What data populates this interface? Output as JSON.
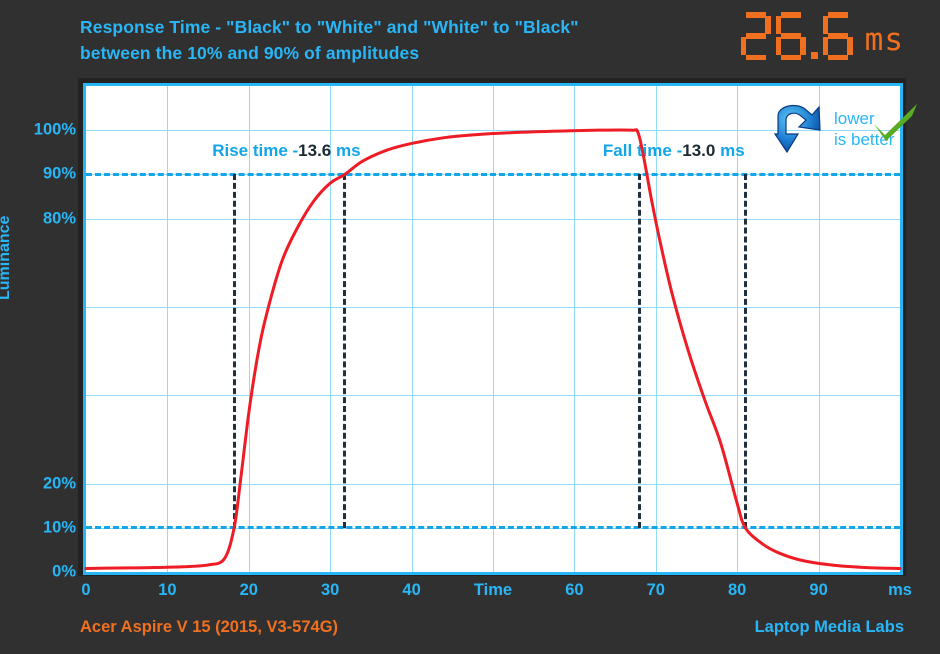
{
  "header": {
    "title_line_1": "Response Time - \"Black\" to \"White\" and \"White\" to \"Black\"",
    "title_line_2": "between the 10% and 90% of amplitudes",
    "readout_value": "26.6",
    "readout_unit": "ms"
  },
  "badge": {
    "line_1": "lower",
    "line_2": "is better",
    "arrow_icon": "down-arrow-icon",
    "check_icon": "green-check-icon"
  },
  "annotations": {
    "rise_label": "Rise time -",
    "rise_value": "13.6",
    "rise_unit": "ms",
    "fall_label": "Fall time -",
    "fall_value": "13.0",
    "fall_unit": "ms"
  },
  "footer": {
    "device": "Acer Aspire V 15 (2015, V3-574G)",
    "source": "Laptop Media Labs"
  },
  "colors": {
    "background": "#303030",
    "accent_cyan": "#29b6f6",
    "accent_orange": "#f07020",
    "curve_red": "#ee1c25",
    "grid_light": "#8fdcfb",
    "marker_dark": "#21303c",
    "plot_bg": "#ffffff"
  },
  "chart_data": {
    "type": "line",
    "title": "Response Time - \"Black\" to \"White\" and \"White\" to \"Black\" between the 10% and 90% of amplitudes",
    "xlabel": "Time",
    "ylabel": "Luminance",
    "x_unit": "ms",
    "y_unit": "%",
    "xlim": [
      0,
      100
    ],
    "ylim": [
      0,
      110
    ],
    "grid": true,
    "legend": "none",
    "x_ticks": [
      {
        "value": 0,
        "label": "0"
      },
      {
        "value": 10,
        "label": "10"
      },
      {
        "value": 20,
        "label": "20"
      },
      {
        "value": 30,
        "label": "30"
      },
      {
        "value": 40,
        "label": "40"
      },
      {
        "value": 50,
        "label": "Time"
      },
      {
        "value": 60,
        "label": "60"
      },
      {
        "value": 70,
        "label": "70"
      },
      {
        "value": 80,
        "label": "80"
      },
      {
        "value": 90,
        "label": "90"
      },
      {
        "value": 100,
        "label": "ms"
      }
    ],
    "y_ticks": [
      {
        "value": 0,
        "label": "0%"
      },
      {
        "value": 10,
        "label": "10%"
      },
      {
        "value": 20,
        "label": "20%"
      },
      {
        "value": 100,
        "label": "100%"
      },
      {
        "value": 90,
        "label": "90%"
      },
      {
        "value": 80,
        "label": "80%"
      }
    ],
    "y_gridlines": [
      10,
      20,
      40,
      60,
      80,
      90,
      100
    ],
    "threshold_lines": [
      {
        "value": 10,
        "style": "dashed",
        "color": "#12a5e8"
      },
      {
        "value": 90,
        "style": "dashed",
        "color": "#12a5e8"
      }
    ],
    "markers": [
      {
        "name": "rise-start",
        "x": 18.2,
        "y_from": 10,
        "y_to": 90
      },
      {
        "name": "rise-end",
        "x": 31.8,
        "y_from": 10,
        "y_to": 90
      },
      {
        "name": "fall-start",
        "x": 68.0,
        "y_from": 10,
        "y_to": 90
      },
      {
        "name": "fall-end",
        "x": 81.0,
        "y_from": 10,
        "y_to": 90
      }
    ],
    "measurements": {
      "rise_time_ms": 13.6,
      "fall_time_ms": 13.0,
      "total_response_ms": 26.6
    },
    "series": [
      {
        "name": "Luminance response",
        "color": "#ee1c25",
        "x": [
          0,
          4,
          8,
          12,
          15,
          17,
          18.2,
          19,
          20,
          21,
          22,
          24,
          26,
          28,
          30,
          31.8,
          34,
          37,
          40,
          44,
          48,
          53,
          58,
          63,
          67,
          67.8,
          68.5,
          69.5,
          70.5,
          72,
          74,
          76,
          78,
          80,
          81,
          83,
          85,
          88,
          92,
          96,
          100
        ],
        "y": [
          0.8,
          0.9,
          1.0,
          1.2,
          1.6,
          3.0,
          10.0,
          21.0,
          36.0,
          48.0,
          57.0,
          70.0,
          78.0,
          84.0,
          88.0,
          90.0,
          93.0,
          95.5,
          97.0,
          98.3,
          99.0,
          99.5,
          99.8,
          100.0,
          100.0,
          99.5,
          94.0,
          84.0,
          75.0,
          63.0,
          50.0,
          39.0,
          29.0,
          15.5,
          10.0,
          6.5,
          4.4,
          2.6,
          1.5,
          1.0,
          0.8
        ]
      }
    ]
  }
}
